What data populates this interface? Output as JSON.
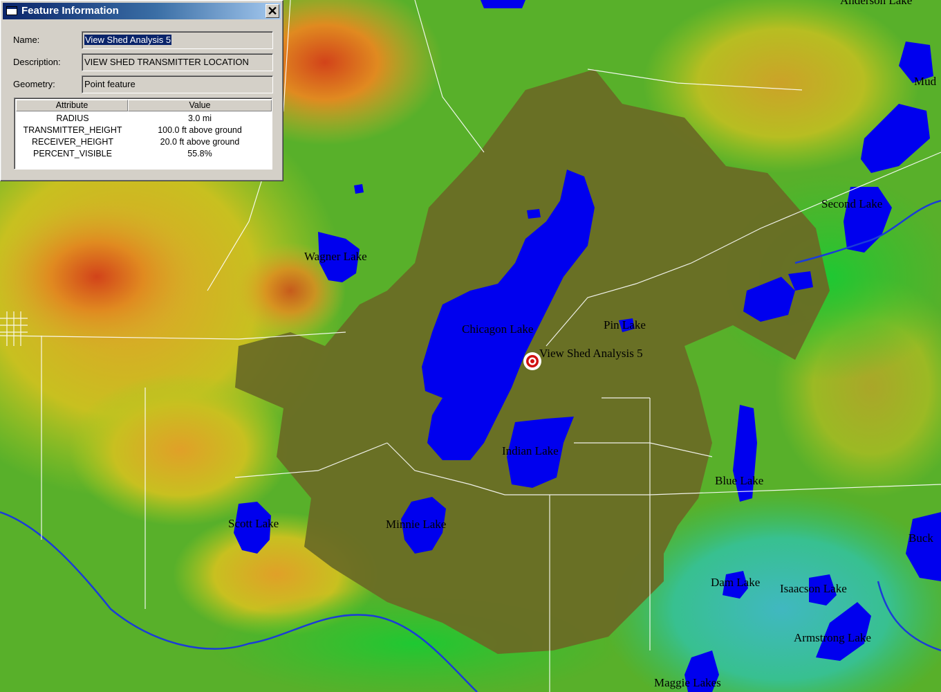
{
  "window": {
    "title": "Feature Information",
    "close_label": "✕",
    "fields": [
      {
        "label": "Name:",
        "value": "View Shed Analysis 5"
      },
      {
        "label": "Description:",
        "value": "VIEW SHED TRANSMITTER LOCATION"
      },
      {
        "label": "Geometry:",
        "value": "Point feature"
      }
    ],
    "table": {
      "headers": [
        "Attribute",
        "Value"
      ],
      "rows": [
        {
          "attribute": "RADIUS",
          "value": "3.0 mi"
        },
        {
          "attribute": "TRANSMITTER_HEIGHT",
          "value": "100.0 ft above ground"
        },
        {
          "attribute": "RECEIVER_HEIGHT",
          "value": "20.0 ft above ground"
        },
        {
          "attribute": "PERCENT_VISIBLE",
          "value": "55.8%"
        }
      ]
    }
  },
  "map": {
    "marker_label": "View Shed Analysis 5",
    "lakes": [
      "Wagner Lake",
      "Chicagon Lake",
      "Pin Lake",
      "Indian Lake",
      "Scott Lake",
      "Minnie Lake",
      "Blue Lake",
      "Dam Lake",
      "Isaacson Lake",
      "Armstrong Lake",
      "Maggie Lakes",
      "Second Lake",
      "Buck",
      "Mud",
      "Anderson Lake"
    ],
    "colors": {
      "water": "#0000ee",
      "viewshed": "#6b6a25",
      "high_terrain": "#d85a10",
      "mid_terrain": "#c8c020",
      "low_terrain": "#2ac03a",
      "lowest_terrain": "#38c0a8",
      "roads": "#ffffff",
      "marker": "#d01010"
    }
  }
}
